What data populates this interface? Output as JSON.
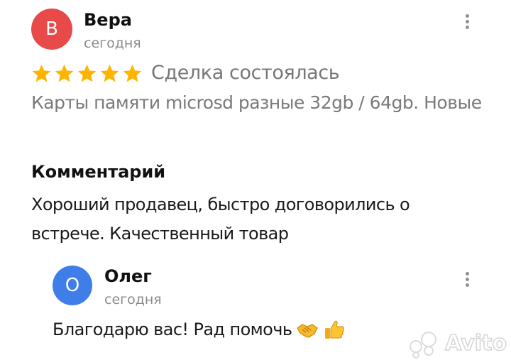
{
  "review": {
    "avatar_letter": "В",
    "avatar_color": "#e84a4a",
    "author": "Вера",
    "date": "сегодня",
    "rating": 5,
    "star_color": "#ffb400",
    "deal_status": "Сделка состоялась",
    "item_title": "Карты памяти microsd разные 32gb / 64gb. Новые",
    "comment_heading": "Комментарий",
    "comment_text": "Хороший продавец, быстро договорились о встрече. Качественный товар",
    "menu_icon": "more-vertical-icon"
  },
  "reply": {
    "avatar_letter": "О",
    "avatar_color": "#3f7ee8",
    "author": "Олег",
    "date": "сегодня",
    "text": "Благодарю вас! Рад помочь",
    "emojis": [
      "handshake-emoji",
      "thumbs-up-emoji"
    ],
    "menu_icon": "more-vertical-icon"
  },
  "watermark": {
    "text": "Avito"
  }
}
